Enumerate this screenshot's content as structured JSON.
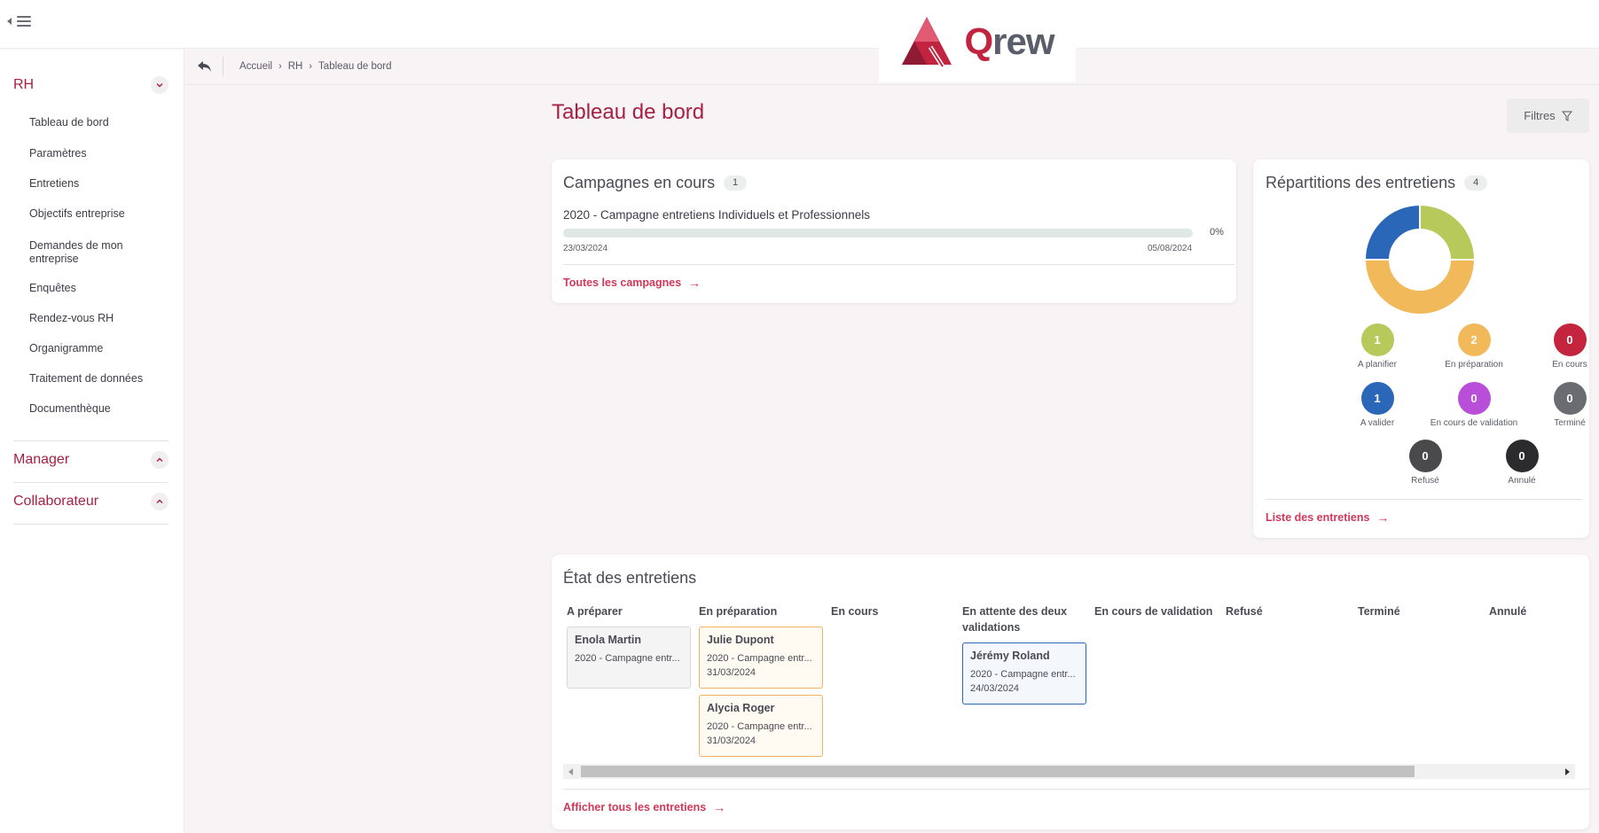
{
  "brand": {
    "logo_q": "Q",
    "logo_rest": "rew",
    "primary_color": "#a82043",
    "link_color": "#d2385a"
  },
  "sidebar": {
    "sections": [
      {
        "title": "RH",
        "expanded": true,
        "items": [
          "Tableau de bord",
          "Paramètres",
          "Entretiens",
          "Objectifs entreprise",
          "Demandes de mon entreprise",
          "Enquêtes",
          "Rendez-vous RH",
          "Organigramme",
          "Traitement de données",
          "Documenthèque"
        ]
      },
      {
        "title": "Manager",
        "expanded": false
      },
      {
        "title": "Collaborateur",
        "expanded": false
      }
    ]
  },
  "breadcrumb": [
    "Accueil",
    "RH",
    "Tableau de bord"
  ],
  "page": {
    "title": "Tableau de bord",
    "filter_label": "Filtres"
  },
  "campaigns": {
    "title": "Campagnes en cours",
    "count": "1",
    "items": [
      {
        "name": "2020 - Campagne entretiens Individuels et Professionnels",
        "progress": 0,
        "progress_label": "0%",
        "start": "23/03/2024",
        "end": "05/08/2024"
      }
    ],
    "link_label": "Toutes les campagnes"
  },
  "repartition": {
    "title": "Répartitions des entretiens",
    "count": "4",
    "chart_data": {
      "type": "pie",
      "categories": [
        "A planifier",
        "En préparation",
        "A valider"
      ],
      "values": [
        1,
        2,
        1
      ],
      "colors": [
        "#b8c95b",
        "#f2b95a",
        "#2a67b8"
      ]
    },
    "stats": [
      {
        "label": "A planifier",
        "value": "1",
        "color": "#b8c95b"
      },
      {
        "label": "En préparation",
        "value": "2",
        "color": "#f2b95a"
      },
      {
        "label": "En cours",
        "value": "0",
        "color": "#c5243f"
      },
      {
        "label": "A valider",
        "value": "1",
        "color": "#2a67b8"
      },
      {
        "label": "En cours de validation",
        "value": "0",
        "color": "#b94fd8"
      },
      {
        "label": "Terminé",
        "value": "0",
        "color": "#6b6c72"
      },
      {
        "label": "Refusé",
        "value": "0",
        "color": "#4a4a4d"
      },
      {
        "label": "Annulé",
        "value": "0",
        "color": "#2b2b2d"
      }
    ],
    "link_label": "Liste des entretiens"
  },
  "etat": {
    "title": "État des entretiens",
    "columns": [
      {
        "label": "A préparer"
      },
      {
        "label": "En préparation"
      },
      {
        "label": "En cours"
      },
      {
        "label": "En attente des deux validations"
      },
      {
        "label": "En cours de validation"
      },
      {
        "label": "Refusé"
      },
      {
        "label": "Terminé"
      },
      {
        "label": "Annulé"
      }
    ],
    "cards": [
      {
        "name": "Enola Martin",
        "campaign": "2020 - Campagne entr...",
        "date": ""
      },
      {
        "name": "Julie Dupont",
        "campaign": "2020 - Campagne entr...",
        "date": "31/03/2024"
      },
      {
        "name": "Alycia Roger",
        "campaign": "2020 - Campagne entr...",
        "date": "31/03/2024"
      },
      {
        "name": "Jérémy Roland",
        "campaign": "2020 - Campagne entr...",
        "date": "24/03/2024"
      }
    ],
    "link_label": "Afficher tous les entretiens"
  }
}
